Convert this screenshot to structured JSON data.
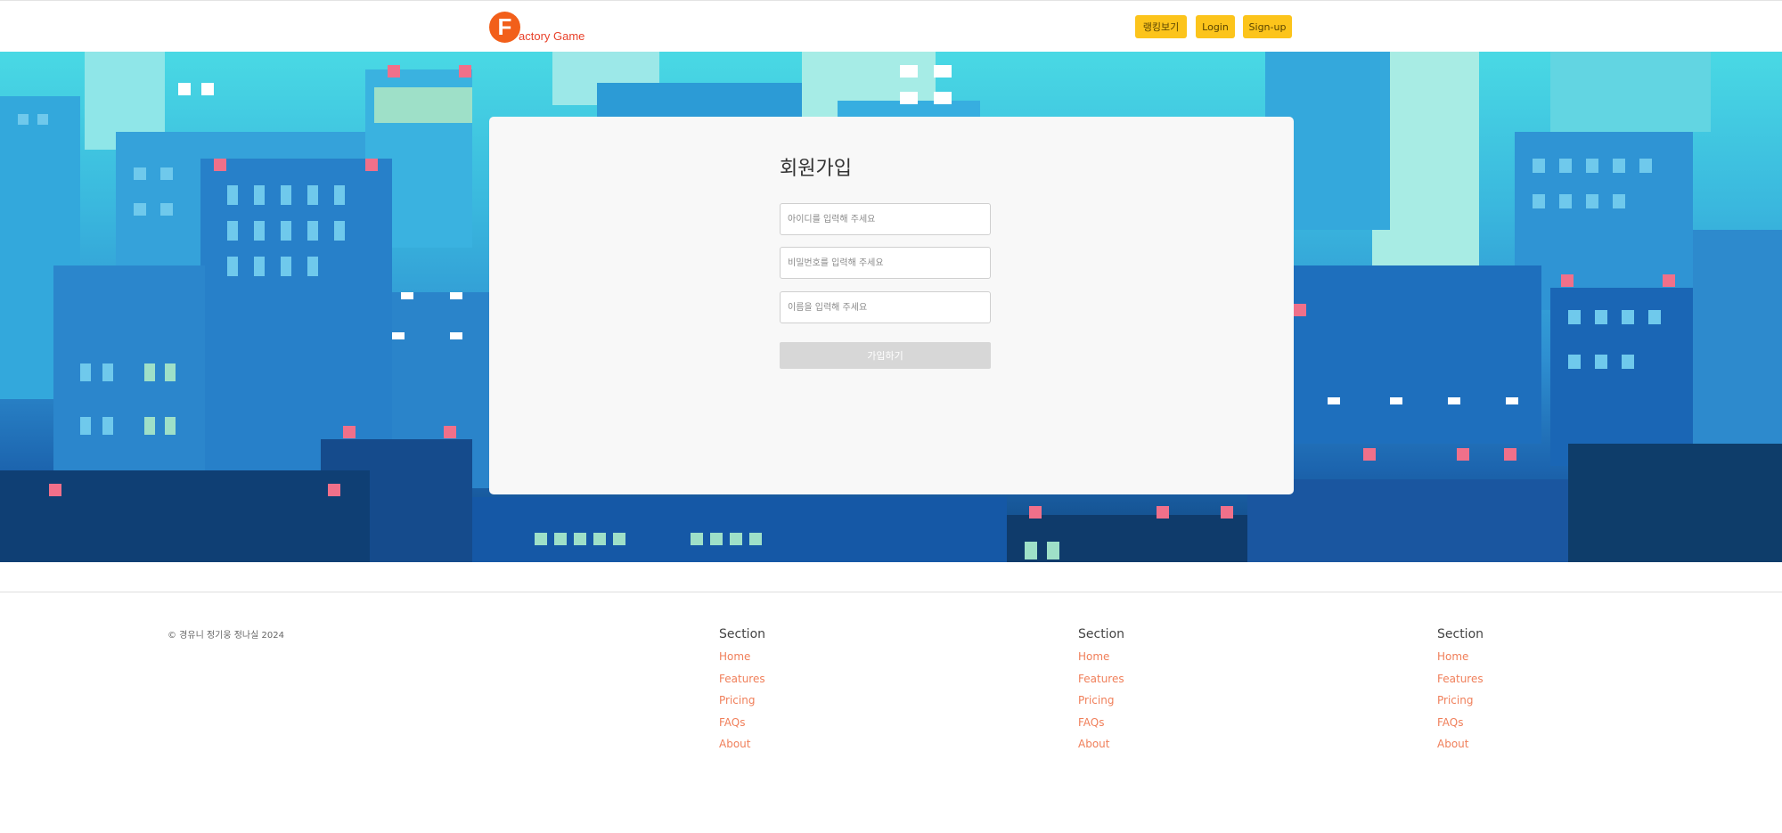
{
  "header": {
    "logo_letter": "F",
    "logo_text": "actory Game",
    "nav": {
      "ranking": "랭킹보기",
      "login": "Login",
      "signup": "Sign-up"
    }
  },
  "signup": {
    "title": "회원가입",
    "id_placeholder": "아이디를 입력해 주세요",
    "password_placeholder": "비밀번호를 입력해 주세요",
    "name_placeholder": "이름을 입력해 주세요",
    "submit_label": "가입하기"
  },
  "footer": {
    "copyright": "© 경유니 정기웅 정나실 2024",
    "columns": [
      {
        "title": "Section",
        "links": [
          "Home",
          "Features",
          "Pricing",
          "FAQs",
          "About"
        ]
      },
      {
        "title": "Section",
        "links": [
          "Home",
          "Features",
          "Pricing",
          "FAQs",
          "About"
        ]
      },
      {
        "title": "Section",
        "links": [
          "Home",
          "Features",
          "Pricing",
          "FAQs",
          "About"
        ]
      }
    ]
  },
  "colors": {
    "accent": "#fcc41b",
    "logo": "#f25f1a",
    "link": "#f07f5a",
    "card": "#f8f8f8"
  }
}
